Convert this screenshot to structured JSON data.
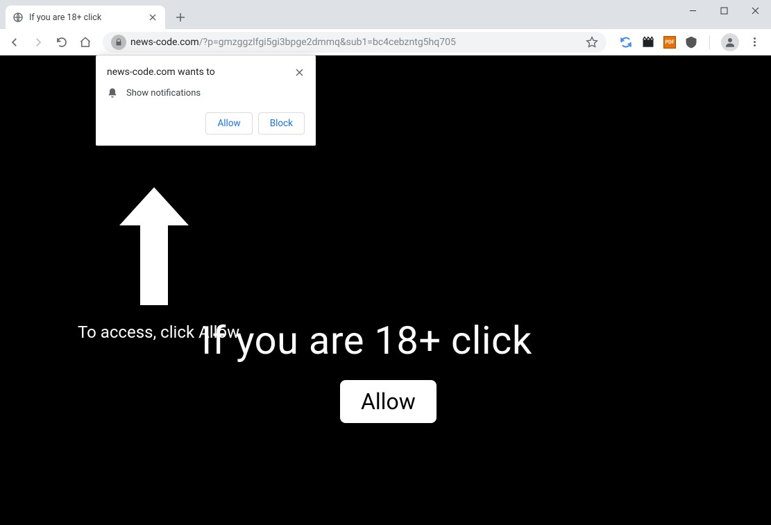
{
  "browser": {
    "tab_title": "If you are 18+ click",
    "url_domain": "news-code.com",
    "url_path": "/?p=gmzggzlfgi5gi3bpge2dmmq&sub1=bc4cebzntg5hq705"
  },
  "permission_prompt": {
    "title": "news-code.com wants to",
    "body": "Show notifications",
    "allow_label": "Allow",
    "block_label": "Block"
  },
  "page": {
    "access_text": "To access, click Allow",
    "headline": "If you are 18+ click",
    "allow_button": "Allow"
  }
}
